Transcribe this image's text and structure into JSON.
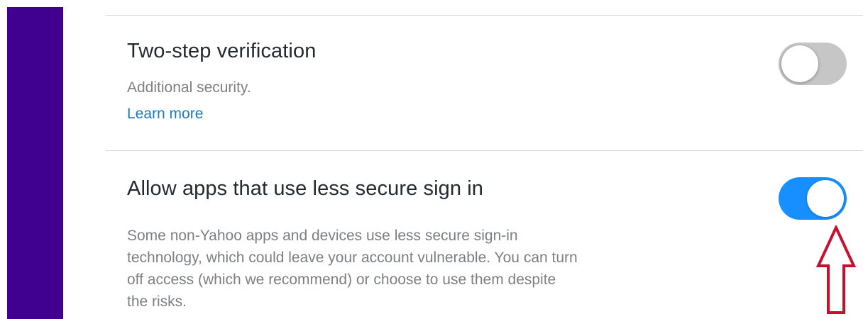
{
  "settings": [
    {
      "title": "Two-step verification",
      "subtitle": "Additional security.",
      "link": "Learn more",
      "toggle_state": "off"
    },
    {
      "title": "Allow apps that use less secure sign in",
      "description_lines": [
        "Some non-Yahoo apps and devices use less secure sign-in",
        "technology, which could leave your account vulnerable. You can turn",
        "off access (which we recommend) or choose to use them despite",
        "the risks."
      ],
      "toggle_state": "on"
    }
  ],
  "icons": {
    "annotation_arrow": "arrow-up-icon"
  },
  "colors": {
    "sidebar": "#400090",
    "toggle_on": "#188fff",
    "toggle_off": "#c6c6c6",
    "link": "#1a7bc0",
    "annotation_arrow": "#c8102e"
  }
}
